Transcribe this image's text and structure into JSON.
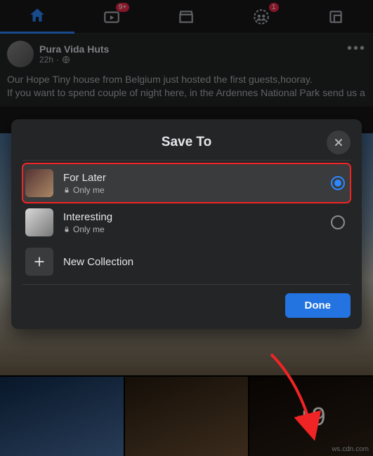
{
  "tabbar": {
    "video_badge": "9+",
    "groups_badge": "1"
  },
  "post": {
    "author": "Pura Vida Huts",
    "time": "22h",
    "body_line1": "Our Hope Tiny house from Belgium just hosted the first guests,hooray.",
    "body_line2": "If you want to spend couple of night here, in the Ardennes National Park send us a"
  },
  "photos": {
    "more_count": "+9"
  },
  "modal": {
    "title": "Save To",
    "collections": [
      {
        "name": "For Later",
        "privacy": "Only me",
        "selected": true
      },
      {
        "name": "Interesting",
        "privacy": "Only me",
        "selected": false
      }
    ],
    "new_collection_label": "New Collection",
    "done_label": "Done"
  },
  "watermark": "ws.cdn.com"
}
